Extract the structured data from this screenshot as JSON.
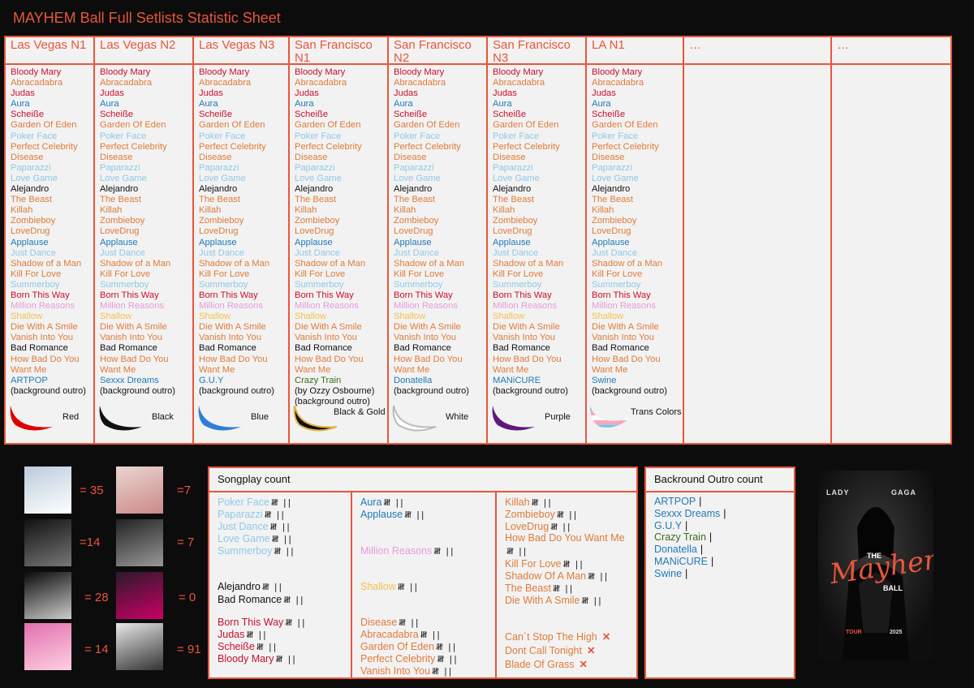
{
  "title": "MAYHEM Ball Full Setlists Statistic Sheet",
  "colors": {
    "accent": "#e8563a",
    "red": "#c8102e",
    "orange": "#e07b39",
    "lightblue": "#8ec9e8",
    "blue": "#1f7ab8",
    "black": "#111111",
    "pink": "#e89ad8",
    "yellow": "#f2c14e",
    "green": "#3b6b1e"
  },
  "shows": [
    {
      "name": "Las Vegas N1",
      "extra": [
        "(background outro)"
      ],
      "blade_label": "Red",
      "blade_icon": "red-blade-icon"
    },
    {
      "name": "Las Vegas N2",
      "extra": [
        "(background outro)"
      ],
      "blade_label": "Black",
      "blade_icon": "black-blade-icon"
    },
    {
      "name": "Las Vegas N3",
      "extra": [
        "(background outro)"
      ],
      "blade_label": "Blue",
      "blade_icon": "blue-blade-icon"
    },
    {
      "name": "San Francisco N1",
      "extra": [
        "(by Ozzy Osbourne)",
        "(background outro)"
      ],
      "blade_label": "Black & Gold",
      "blade_icon": "black-gold-blade-icon"
    },
    {
      "name": "San Francisco N2",
      "extra": [
        "(background outro)"
      ],
      "blade_label": "White",
      "blade_icon": "white-blade-icon"
    },
    {
      "name": "San Francisco N3",
      "extra": [
        "(background outro)"
      ],
      "blade_label": "Purple",
      "blade_icon": "purple-blade-icon"
    },
    {
      "name": "LA N1",
      "extra": [
        "(background outro)"
      ],
      "blade_label": "Trans Colors",
      "blade_icon": "trans-blade-icon"
    },
    {
      "name": "…"
    },
    {
      "name": "…"
    }
  ],
  "common_setlist": [
    {
      "t": "Bloody Mary",
      "c": "red"
    },
    {
      "t": "Abracadabra",
      "c": "orange"
    },
    {
      "t": "Judas",
      "c": "red"
    },
    {
      "t": "Aura",
      "c": "blue"
    },
    {
      "t": "Scheiße",
      "c": "red"
    },
    {
      "t": "Garden Of Eden",
      "c": "orange"
    },
    {
      "t": "Poker Face",
      "c": "lightblue"
    },
    {
      "t": "Perfect Celebrity",
      "c": "orange"
    },
    {
      "t": "Disease",
      "c": "orange"
    },
    {
      "t": "Paparazzi",
      "c": "lightblue"
    },
    {
      "t": "Love Game",
      "c": "lightblue"
    },
    {
      "t": "Alejandro",
      "c": "black"
    },
    {
      "t": "The Beast",
      "c": "orange"
    },
    {
      "t": "Killah",
      "c": "orange"
    },
    {
      "t": "Zombieboy",
      "c": "orange"
    },
    {
      "t": "LoveDrug",
      "c": "orange"
    },
    {
      "t": "Applause",
      "c": "blue"
    },
    {
      "t": "Just Dance",
      "c": "lightblue"
    },
    {
      "t": "Shadow of a Man",
      "c": "orange"
    },
    {
      "t": "Kill For Love",
      "c": "orange"
    },
    {
      "t": "Summerboy",
      "c": "lightblue"
    },
    {
      "t": "Born This Way",
      "c": "red"
    },
    {
      "t": "Million Reasons",
      "c": "pink"
    },
    {
      "t": "Shallow",
      "c": "yellow"
    },
    {
      "t": "Die With A Smile",
      "c": "orange"
    },
    {
      "t": "Vanish Into You",
      "c": "orange"
    },
    {
      "t": "Bad Romance",
      "c": "black"
    },
    {
      "t": "How Bad Do You",
      "c": "orange"
    },
    {
      "t": "Want Me",
      "c": "orange"
    }
  ],
  "surprise_songs": [
    {
      "t": "ARTPOP",
      "c": "blue"
    },
    {
      "t": "Sexxx Dreams",
      "c": "blue"
    },
    {
      "t": "G.U.Y",
      "c": "blue"
    },
    {
      "t": "Crazy Train",
      "c": "green"
    },
    {
      "t": "Donatella",
      "c": "blue"
    },
    {
      "t": "MANiCURE",
      "c": "blue"
    },
    {
      "t": "Swine",
      "c": "blue"
    }
  ],
  "albums": [
    {
      "name": "album-the-fame",
      "count": "= 35"
    },
    {
      "name": "album-joanne",
      "count": "=7"
    },
    {
      "name": "album-the-fame-monster",
      "count": "=14"
    },
    {
      "name": "album-a-star-is-born",
      "count": "= 7"
    },
    {
      "name": "album-born-this-way",
      "count": "= 28"
    },
    {
      "name": "album-chromatica",
      "count": "= 0"
    },
    {
      "name": "album-artpop",
      "count": "= 14"
    },
    {
      "name": "album-mayhem",
      "count": "= 91"
    }
  ],
  "songplay": {
    "title": "Songplay count",
    "col1": [
      {
        "t": "Poker Face",
        "c": "lightblue",
        "tally": "𝍸 ||"
      },
      {
        "t": "Paparazzi",
        "c": "lightblue",
        "tally": "𝍸 ||"
      },
      {
        "t": "Just Dance",
        "c": "lightblue",
        "tally": "𝍸 ||"
      },
      {
        "t": "Love Game",
        "c": "lightblue",
        "tally": "𝍸 ||"
      },
      {
        "t": "Summerboy",
        "c": "lightblue",
        "tally": "𝍸 ||"
      },
      {
        "t": "Alejandro",
        "c": "black",
        "tally": "𝍸 ||"
      },
      {
        "t": "Bad Romance",
        "c": "black",
        "tally": "𝍸 ||"
      },
      {
        "t": "Born This Way",
        "c": "red",
        "tally": "𝍸 ||"
      },
      {
        "t": "Judas",
        "c": "red",
        "tally": "𝍸 ||"
      },
      {
        "t": "Scheiße",
        "c": "red",
        "tally": "𝍸 ||"
      },
      {
        "t": "Bloody Mary",
        "c": "red",
        "tally": "𝍸 ||"
      }
    ],
    "col2": [
      {
        "t": "Aura",
        "c": "blue",
        "tally": "𝍸 ||"
      },
      {
        "t": "Applause",
        "c": "blue",
        "tally": "𝍸 ||"
      },
      {
        "t": "Million Reasons",
        "c": "pink",
        "tally": "𝍸 ||"
      },
      {
        "t": "Shallow",
        "c": "yellow",
        "tally": "𝍸 ||"
      },
      {
        "t": "Disease",
        "c": "orange",
        "tally": "𝍸 ||"
      },
      {
        "t": "Abracadabra",
        "c": "orange",
        "tally": "𝍸 ||"
      },
      {
        "t": "Garden Of Eden",
        "c": "orange",
        "tally": "𝍸 ||"
      },
      {
        "t": "Perfect Celebrity",
        "c": "orange",
        "tally": "𝍸 ||"
      },
      {
        "t": "Vanish Into You",
        "c": "orange",
        "tally": "𝍸 ||"
      }
    ],
    "col3": [
      {
        "t": "Killah",
        "c": "orange",
        "tally": "𝍸 ||"
      },
      {
        "t": "Zombieboy",
        "c": "orange",
        "tally": "𝍸 ||"
      },
      {
        "t": "LoveDrug",
        "c": "orange",
        "tally": "𝍸 ||"
      },
      {
        "t": "How Bad Do You Want Me",
        "c": "orange",
        "tally": ""
      },
      {
        "t": "",
        "c": "orange",
        "tally": "𝍸 ||"
      },
      {
        "t": "Kill For Love",
        "c": "orange",
        "tally": "𝍸 ||"
      },
      {
        "t": "Shadow Of A Man",
        "c": "orange",
        "tally": "𝍸 ||"
      },
      {
        "t": "The Beast",
        "c": "orange",
        "tally": "𝍸 ||"
      },
      {
        "t": "Die With A Smile",
        "c": "orange",
        "tally": "𝍸 ||"
      },
      {
        "t": "Can´t Stop The High",
        "c": "orange",
        "x": "✕"
      },
      {
        "t": "Dont Call Tonight",
        "c": "orange",
        "x": "✕"
      },
      {
        "t": "Blade Of Grass",
        "c": "orange",
        "x": "✕"
      }
    ]
  },
  "outro": {
    "title": "Backround Outro count",
    "items": [
      {
        "t": "ARTPOP",
        "c": "blue",
        "tally": "|"
      },
      {
        "t": "Sexxx Dreams",
        "c": "blue",
        "tally": "|"
      },
      {
        "t": "G.U.Y",
        "c": "blue",
        "tally": "|"
      },
      {
        "t": "Crazy Train",
        "c": "green",
        "tally": "|"
      },
      {
        "t": "Donatella",
        "c": "blue",
        "tally": "|"
      },
      {
        "t": "MANiCURE",
        "c": "blue",
        "tally": "|"
      },
      {
        "t": "Swine",
        "c": "blue",
        "tally": "|"
      }
    ]
  },
  "poster": {
    "artist_left": "LADY",
    "artist_right": "GAGA",
    "the": "THE",
    "mayhem": "Mayhem",
    "ball": "BALL",
    "tour": "TOUR",
    "year": "2025"
  }
}
